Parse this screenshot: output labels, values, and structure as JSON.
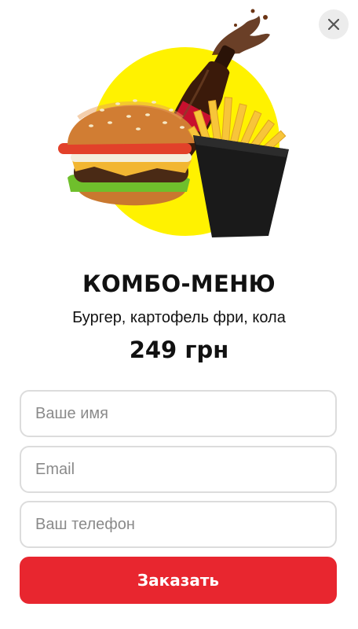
{
  "product": {
    "title": "КОМБО-МЕНЮ",
    "subtitle": "Бургер, картофель фри, кола",
    "price": "249 грн",
    "image_icon": "combo-meal-image"
  },
  "form": {
    "name_placeholder": "Ваше имя",
    "email_placeholder": "Email",
    "phone_placeholder": "Ваш телефон",
    "submit_label": "Заказать"
  },
  "colors": {
    "accent": "#e8262f",
    "hero_circle": "#fff200",
    "close_bg": "#ececec"
  }
}
